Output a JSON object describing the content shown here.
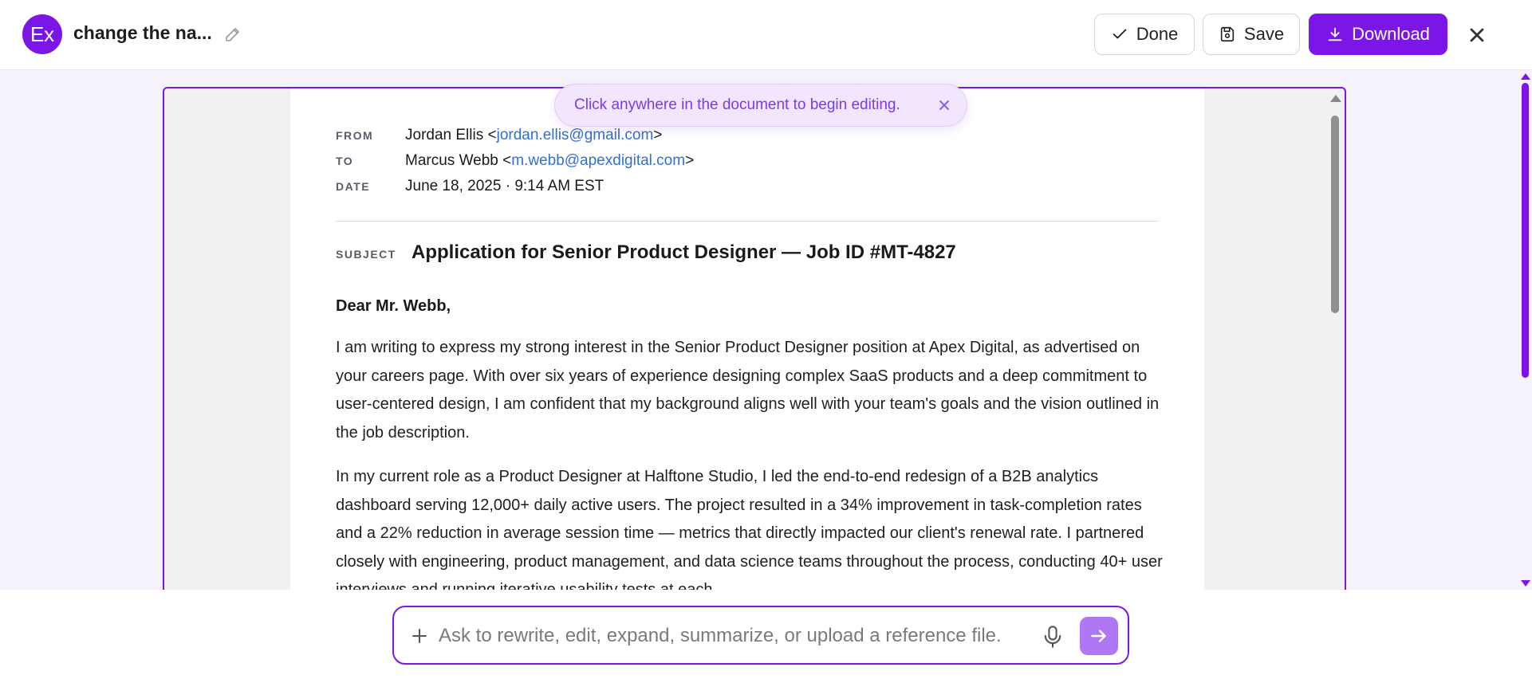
{
  "header": {
    "avatar_text": "Ex",
    "title": "change the na...",
    "done_label": "Done",
    "save_label": "Save",
    "download_label": "Download"
  },
  "toast": {
    "message": "Click anywhere in the document to begin editing."
  },
  "email": {
    "from_label": "FROM",
    "from_name": "Jordan Ellis <",
    "from_email": "jordan.ellis@gmail.com",
    "from_close": ">",
    "to_label": "TO",
    "to_name": "Marcus Webb <",
    "to_email": "m.webb@apexdigital.com",
    "to_close": ">",
    "date_label": "DATE",
    "date_value": "June 18, 2025 · 9:14 AM EST",
    "subject_label": "SUBJECT",
    "subject": "Application for Senior Product Designer — Job ID #MT-4827",
    "greeting": "Dear Mr. Webb,",
    "paragraphs": [
      "I am writing to express my strong interest in the Senior Product Designer position at Apex Digital, as advertised on your careers page. With over six years of experience designing complex SaaS products and a deep commitment to user-centered design, I am confident that my background aligns well with your team's goals and the vision outlined in the job description.",
      "In my current role as a Product Designer at Halftone Studio, I led the end-to-end redesign of a B2B analytics dashboard serving 12,000+ daily active users. The project resulted in a 34% improvement in task-completion rates and a 22% reduction in average session time — metrics that directly impacted our client's renewal rate. I partnered closely with engineering, product management, and data science teams throughout the process, conducting 40+ user interviews and running iterative usability tests at each"
    ]
  },
  "composer": {
    "placeholder": "Ask to rewrite, edit, expand, summarize, or upload a reference file."
  },
  "colors": {
    "accent": "#7c16e8",
    "send_button": "#b077f4",
    "toast_bg": "#f1e6fd",
    "link": "#2f6fd6"
  },
  "icons": [
    "pencil-icon",
    "check-icon",
    "save-icon",
    "download-icon",
    "close-icon",
    "plus-icon",
    "microphone-icon",
    "arrow-right-icon"
  ]
}
